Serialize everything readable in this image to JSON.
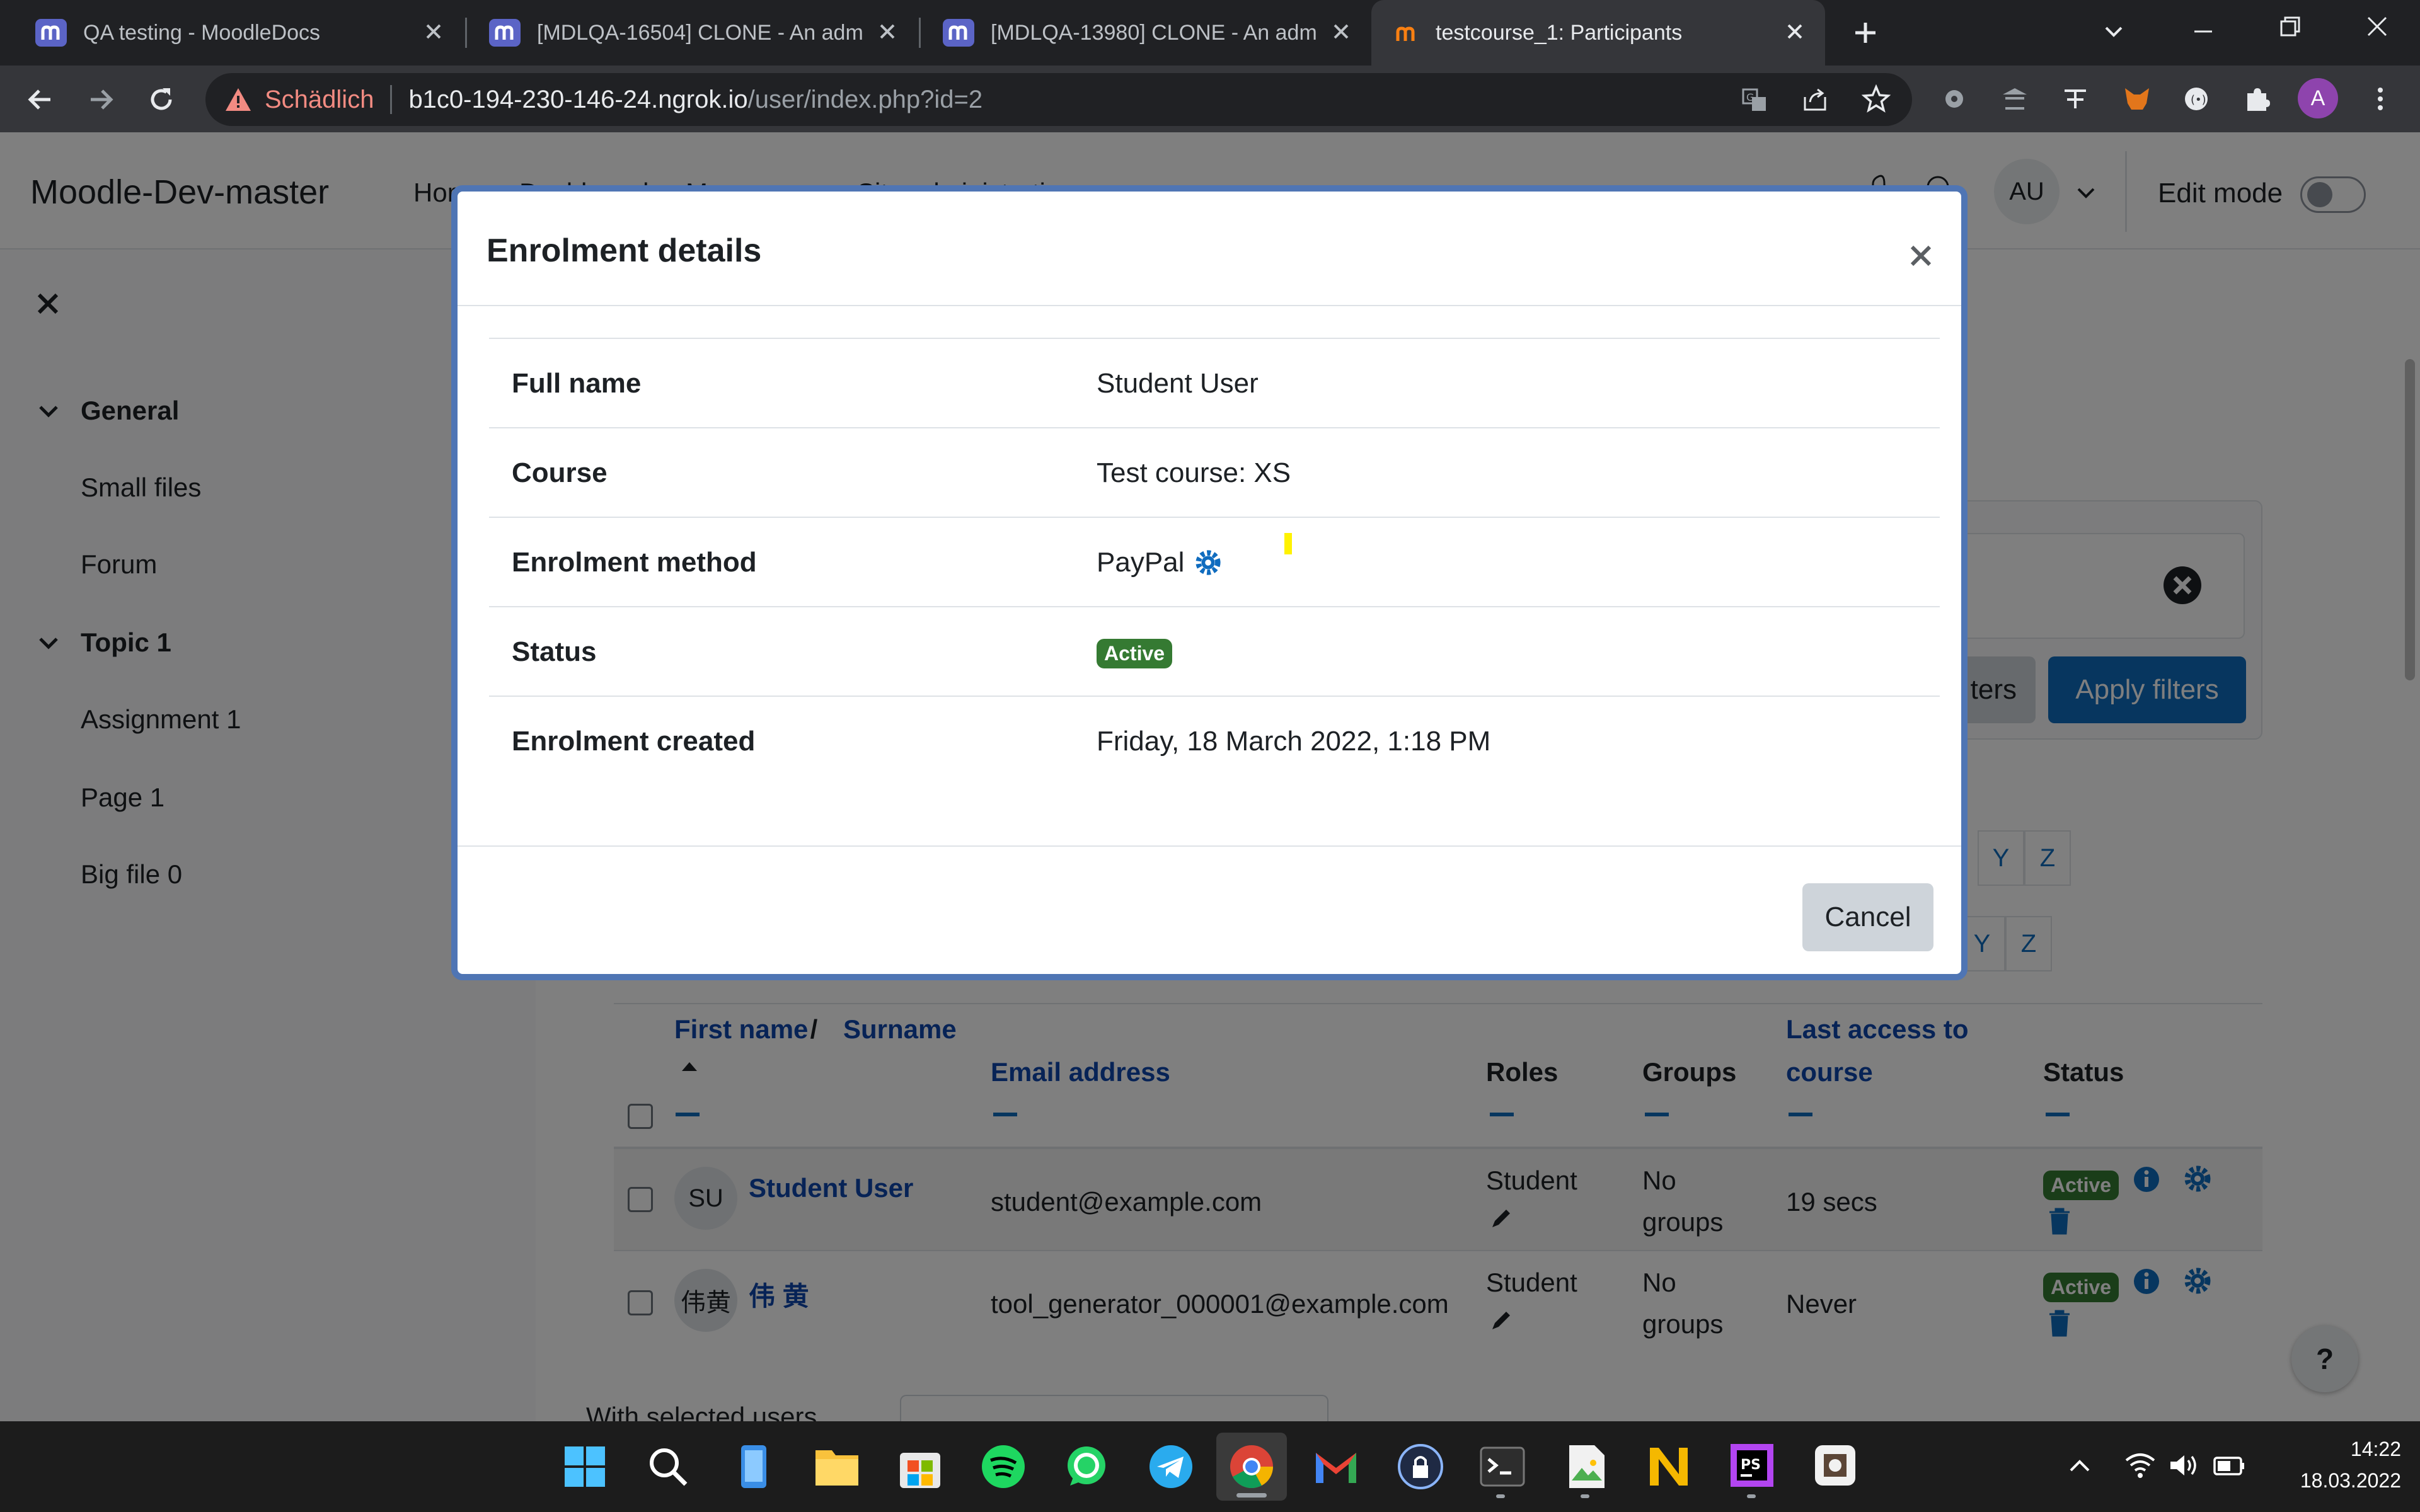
{
  "browser": {
    "tabs": [
      {
        "title": "QA testing - MoodleDocs",
        "active": false
      },
      {
        "title": "[MDLQA-16504] CLONE - An adm",
        "active": false
      },
      {
        "title": "[MDLQA-13980] CLONE - An adm",
        "active": false
      },
      {
        "title": "testcourse_1: Participants",
        "active": true
      }
    ],
    "security_label": "Schädlich",
    "url_host": "b1c0-194-230-146-24.ngrok.io",
    "url_path": "/user/index.php?id=2",
    "profile_initial": "A"
  },
  "moodle": {
    "site_name": "Moodle-Dev-master",
    "nav": [
      "Home",
      "Dashboard",
      "My courses",
      "Site administration"
    ],
    "user_initials": "AU",
    "edit_mode_label": "Edit mode"
  },
  "drawer": {
    "sections": [
      {
        "title": "General",
        "items": [
          "Small files",
          "Forum"
        ]
      },
      {
        "title": "Topic 1",
        "items": [
          "Assignment 1",
          "Page 1",
          "Big file 0"
        ]
      }
    ]
  },
  "filters": {
    "clear_label": "Clear filters",
    "clear_visible": "ters",
    "apply_label": "Apply filters"
  },
  "letters": [
    "Y",
    "Z"
  ],
  "table": {
    "headers": {
      "first_name": "First name",
      "separator": " / ",
      "surname": "Surname",
      "email": "Email address",
      "roles": "Roles",
      "groups": "Groups",
      "last_access_1": "Last access to",
      "last_access_2": "course",
      "status": "Status"
    },
    "rows": [
      {
        "initials": "SU",
        "name": "Student User",
        "email": "student@example.com",
        "role": "Student",
        "groups_1": "No",
        "groups_2": "groups",
        "last_access": "19 secs",
        "status": "Active"
      },
      {
        "initials": "伟黄",
        "name": "伟 黄",
        "email": "tool_generator_000001@example.com",
        "role": "Student",
        "groups_1": "No",
        "groups_2": "groups",
        "last_access": "Never",
        "status": "Active"
      }
    ],
    "with_selected": "With selected users..."
  },
  "modal": {
    "title": "Enrolment details",
    "rows": [
      {
        "label": "Full name",
        "value": "Student User"
      },
      {
        "label": "Course",
        "value": "Test course: XS"
      },
      {
        "label": "Enrolment method",
        "value": "PayPal"
      },
      {
        "label": "Status",
        "value": "Active"
      },
      {
        "label": "Enrolment created",
        "value": "Friday, 18 March 2022, 1:18 PM"
      }
    ],
    "cancel_label": "Cancel"
  },
  "taskbar": {
    "time": "14:22",
    "date": "18.03.2022"
  },
  "colors": {
    "moodle_blue": "#0f6cbf",
    "link_blue": "#0f47ad",
    "active_badge": "#357a32",
    "modal_border": "#4f75b4",
    "warning": "#f28b82"
  }
}
